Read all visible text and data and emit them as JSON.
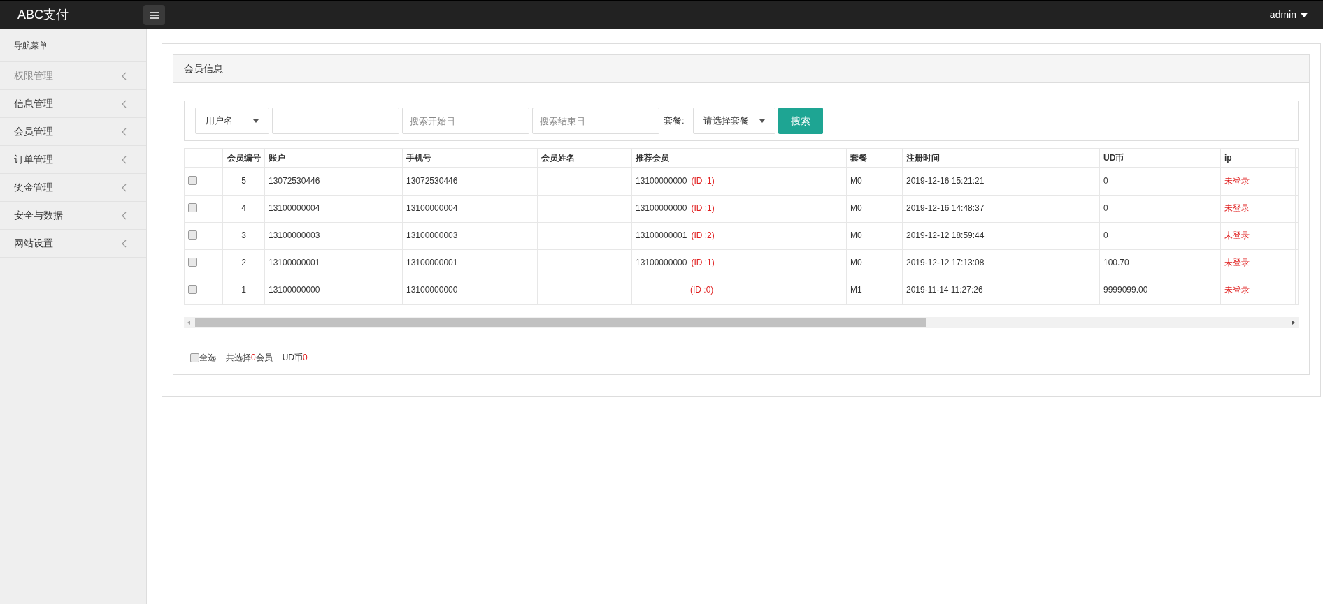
{
  "topbar": {
    "brand": "ABC支付",
    "user": "admin"
  },
  "sidebar": {
    "heading": "导航菜单",
    "items": [
      {
        "label": "权限管理",
        "selected": true
      },
      {
        "label": "信息管理",
        "selected": false
      },
      {
        "label": "会员管理",
        "selected": false
      },
      {
        "label": "订单管理",
        "selected": false
      },
      {
        "label": "奖金管理",
        "selected": false
      },
      {
        "label": "安全与数据",
        "selected": false
      },
      {
        "label": "网站设置",
        "selected": false
      }
    ]
  },
  "panel": {
    "title": "会员信息"
  },
  "filters": {
    "field_select": "用户名",
    "start_date": {
      "placeholder": "搜索开始日"
    },
    "end_date": {
      "placeholder": "搜索结束日"
    },
    "package_label": "套餐:",
    "package_select": "请选择套餐",
    "search_button": "搜索"
  },
  "table": {
    "columns": [
      "会员编号",
      "账户",
      "手机号",
      "会员姓名",
      "推荐会员",
      "套餐",
      "注册时间",
      "UD币",
      "ip"
    ],
    "rows": [
      {
        "checked": false,
        "id": "5",
        "account": "13072530446",
        "phone": "13072530446",
        "referrer": "13100000000",
        "referrer_id": "(ID :1)",
        "package": "M0",
        "registered": "2019-12-16 15:21:21",
        "ud": "0",
        "ip": "未登录"
      },
      {
        "checked": false,
        "id": "4",
        "account": "13100000004",
        "phone": "13100000004",
        "referrer": "13100000000",
        "referrer_id": "(ID :1)",
        "package": "M0",
        "registered": "2019-12-16 14:48:37",
        "ud": "0",
        "ip": "未登录"
      },
      {
        "checked": false,
        "id": "3",
        "account": "13100000003",
        "phone": "13100000003",
        "referrer": "13100000001",
        "referrer_id": "(ID :2)",
        "package": "M0",
        "registered": "2019-12-12 18:59:44",
        "ud": "0",
        "ip": "未登录"
      },
      {
        "checked": false,
        "id": "2",
        "account": "13100000001",
        "phone": "13100000001",
        "referrer": "13100000000",
        "referrer_id": "(ID :1)",
        "package": "M0",
        "registered": "2019-12-12 17:13:08",
        "ud": "100.70",
        "ip": "未登录"
      },
      {
        "checked": false,
        "id": "1",
        "account": "13100000000",
        "phone": "13100000000",
        "referrer_id": "(ID :0)",
        "package": "M1",
        "registered": "2019-11-14 11:27:26",
        "ud": "9999099.00",
        "ip": "未登录"
      }
    ]
  },
  "footer": {
    "select_all": {
      "label": "全选",
      "checked": false
    },
    "selected_prefix": "共选择",
    "selected_count": "0",
    "selected_suffix": "会员",
    "ud_label": "UD币",
    "ud_value": "0"
  }
}
